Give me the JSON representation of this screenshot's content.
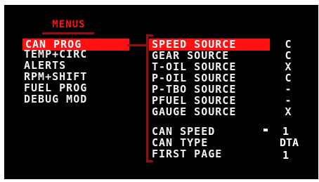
{
  "menu_title": "MENUS",
  "left_menu": [
    {
      "label": "CAN PROG"
    },
    {
      "label": "TEMP+CIRC"
    },
    {
      "label": "ALERTS"
    },
    {
      "label": "RPM+SHIFT"
    },
    {
      "label": "FUEL PROG"
    },
    {
      "label": "DEBUG MOD"
    }
  ],
  "right_menu": [
    {
      "label": "SPEED SOURCE",
      "value": "C"
    },
    {
      "label": "GEAR SOURCE",
      "value": "C"
    },
    {
      "label": "T-OIL SOURCE",
      "value": "X"
    },
    {
      "label": "P-OIL SOURCE",
      "value": "C"
    },
    {
      "label": "P-TBO SOURCE",
      "value": "-"
    },
    {
      "label": "PFUEL SOURCE",
      "value": "-"
    },
    {
      "label": "GAUGE SOURCE",
      "value": "X"
    }
  ],
  "settings": [
    {
      "label": "CAN SPEED",
      "value": "1"
    },
    {
      "label": "CAN TYPE",
      "value": "DTA"
    },
    {
      "label": "FIRST PAGE",
      "value": "1"
    }
  ],
  "colors": {
    "accent": "#ff1010",
    "bracket": "#9a0c0c",
    "background": "#000000"
  }
}
